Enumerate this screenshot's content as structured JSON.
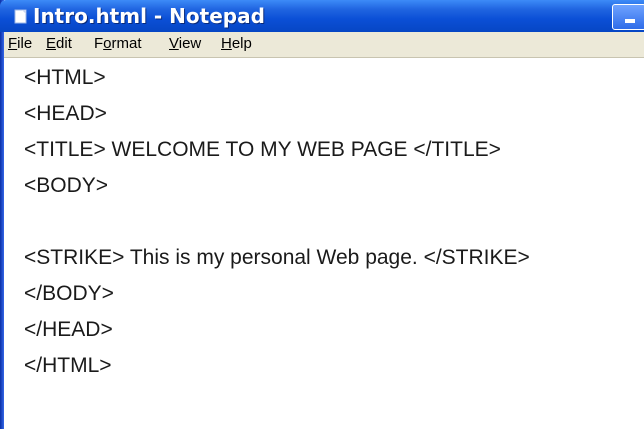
{
  "window": {
    "title": "Intro.html - Notepad"
  },
  "menu": {
    "items": [
      {
        "access_key": "F",
        "rest": "ile"
      },
      {
        "access_key": "E",
        "rest": "dit"
      },
      {
        "lead": "F",
        "access_key": "o",
        "rest": "rmat"
      },
      {
        "access_key": "V",
        "rest": "iew"
      },
      {
        "access_key": "H",
        "rest": "elp"
      }
    ]
  },
  "editor": {
    "lines": [
      "<HTML>",
      "<HEAD>",
      "<TITLE> WELCOME TO MY WEB PAGE </TITLE>",
      "<BODY>",
      "",
      "<STRIKE> This is my personal Web page. </STRIKE>",
      "</BODY>",
      "</HEAD>",
      "</HTML>"
    ]
  },
  "colors": {
    "titlebar": "#0b4fd6",
    "menubar": "#ece9d8",
    "editor_background": "#ffffff"
  },
  "icons": {
    "app_icon": "notepad-icon",
    "minimize": "minimize-icon"
  }
}
